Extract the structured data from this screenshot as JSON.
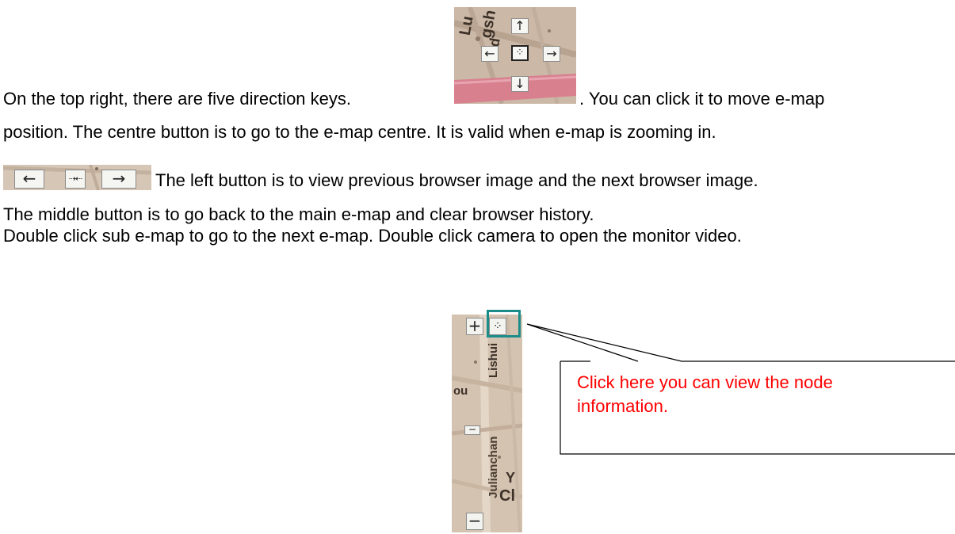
{
  "paragraph": {
    "line1_before": "On the top right, there are five direction keys.",
    "line1_after": ". You can click it to move e-map",
    "line2": "position. The centre button is to go to the e-map centre. It is valid when e-map is zooming in.",
    "line3": "The left button is to view previous browser image and the next browser image.",
    "line4": "The middle button is to go back to the main e-map and clear browser history.",
    "line5": "Double click sub e-map to go to the next e-map. Double click camera to open the monitor video."
  },
  "direction_keys": {
    "up": "↑",
    "left": "←",
    "right": "→",
    "down": "↓",
    "center": "⁘",
    "map_labels": [
      "Lu",
      "gsh",
      "d"
    ]
  },
  "browser_nav": {
    "prev": "←",
    "home": "⇢⇠",
    "next": "→"
  },
  "vertical_map": {
    "zoom_in": "+",
    "node_info": "⁘",
    "zoom_out": "−",
    "zoom_slider": "−",
    "map_labels": [
      "Lishui",
      "ou",
      "Julianchan",
      "Y",
      "Cl"
    ]
  },
  "callout": {
    "text": "Click here you can view the node information."
  },
  "colors": {
    "callout_text": "#ff0000",
    "highlight_border": "#1a8d8a",
    "map_base": "#cbb8a6",
    "map_road_pink": "#d9808f"
  }
}
